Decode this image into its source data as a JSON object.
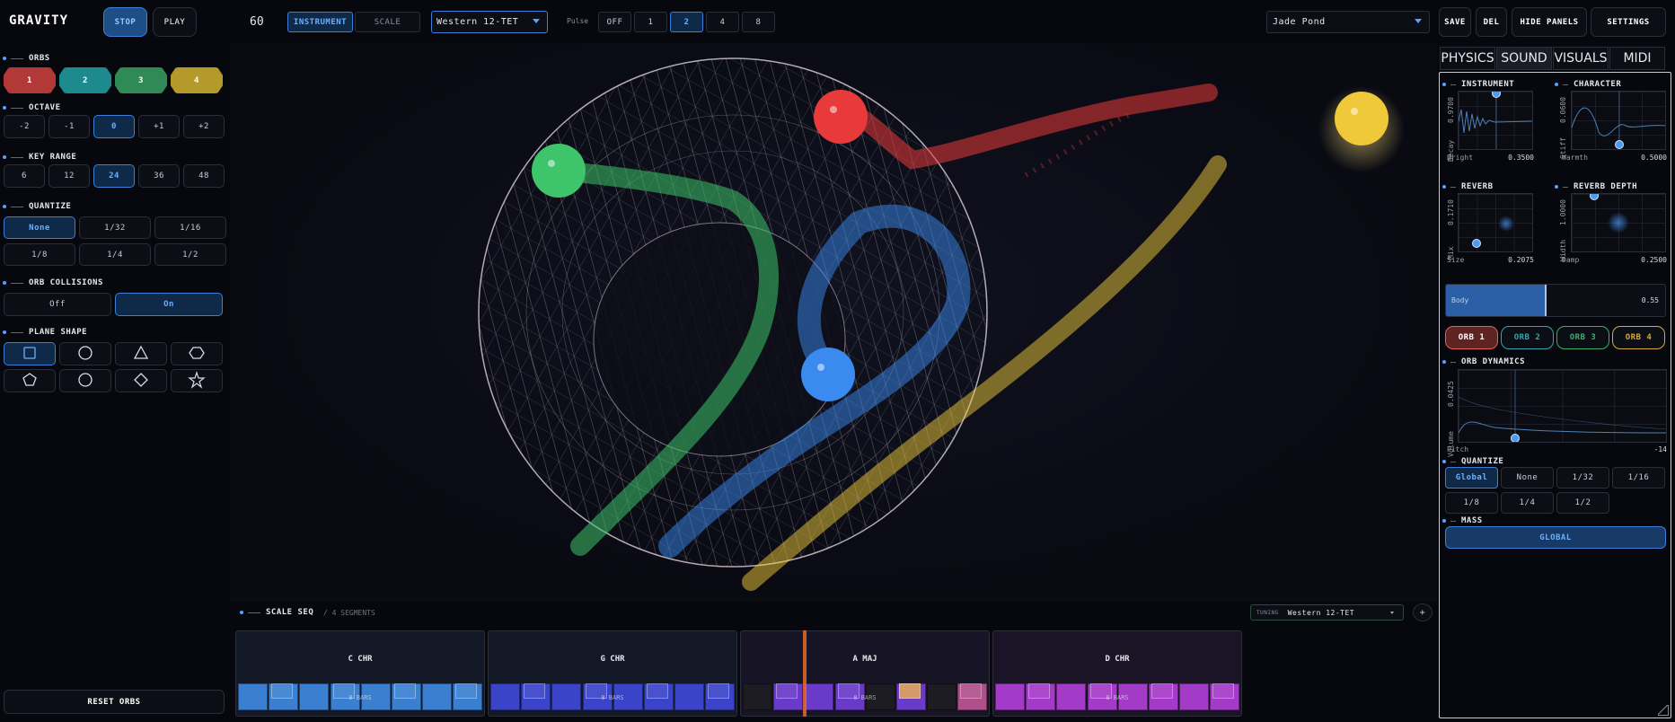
{
  "app": {
    "title": "GRAVITY"
  },
  "transport": {
    "stop_label": "STOP",
    "play_label": "PLAY",
    "bpm": "60"
  },
  "mode": {
    "instrument_label": "INSTRUMENT",
    "scale_label": "SCALE"
  },
  "tuning_select": {
    "value": "Western 12-TET"
  },
  "pulse": {
    "label": "Pulse",
    "options": [
      "OFF",
      "1",
      "2",
      "4",
      "8"
    ],
    "selected": "2"
  },
  "preset": {
    "value": "Jade Pond",
    "save_label": "SAVE",
    "del_label": "DEL",
    "hide_label": "HIDE PANELS",
    "settings_label": "SETTINGS"
  },
  "sidebar": {
    "orbs_label": "ORBS",
    "orbs": [
      {
        "label": "1",
        "color": "#b33838"
      },
      {
        "label": "2",
        "color": "#1d8a8e"
      },
      {
        "label": "3",
        "color": "#2f8a55"
      },
      {
        "label": "4",
        "color": "#b39a2a"
      }
    ],
    "octave_label": "OCTAVE",
    "octave": [
      "-2",
      "-1",
      "0",
      "+1",
      "+2"
    ],
    "octave_selected": "0",
    "keyrange_label": "KEY RANGE",
    "keyrange": [
      "6",
      "12",
      "24",
      "36",
      "48"
    ],
    "keyrange_selected": "24",
    "quantize_label": "QUANTIZE",
    "quantize_row1": [
      "None",
      "1/32",
      "1/16"
    ],
    "quantize_row2": [
      "1/8",
      "1/4",
      "1/2"
    ],
    "quantize_selected": "None",
    "collisions_label": "ORB COLLISIONS",
    "collisions": [
      "Off",
      "On"
    ],
    "collisions_selected": "On",
    "plane_label": "PLANE SHAPE",
    "planes": [
      "square-icon",
      "circle-icon",
      "triangle-icon",
      "hexagon-icon",
      "pentagon-icon",
      "circle-icon",
      "diamond-icon",
      "star-icon"
    ],
    "reset_label": "RESET ORBS"
  },
  "canvas": {
    "orbs": [
      {
        "name": "orb-green",
        "color": "#3ec46a"
      },
      {
        "name": "orb-red",
        "color": "#e83a3a"
      },
      {
        "name": "orb-yellow",
        "color": "#f0c93a"
      },
      {
        "name": "orb-blue",
        "color": "#3a8af0"
      }
    ]
  },
  "right_panel": {
    "tabs": [
      "PHYSICS",
      "SOUND",
      "VISUALS",
      "MIDI"
    ],
    "selected_tab": "SOUND",
    "instrument": {
      "title": "INSTRUMENT",
      "y_label": "Decay",
      "y_value": "0.9700",
      "x_label": "Bright",
      "x_value": "0.3500"
    },
    "character": {
      "title": "CHARACTER",
      "y_label": "Stiff",
      "y_value": "0.0600",
      "x_label": "Warmth",
      "x_value": "0.5000"
    },
    "reverb": {
      "title": "REVERB",
      "y_label": "Mix",
      "y_value": "0.1710",
      "x_label": "Size",
      "x_value": "0.2075"
    },
    "reverb_depth": {
      "title": "REVERB DEPTH",
      "y_label": "Width",
      "y_value": "1.0000",
      "x_label": "Damp",
      "x_value": "0.2500"
    },
    "body": {
      "label": "Body",
      "value": "0.55",
      "fraction": 0.55
    },
    "orb_tabs": [
      {
        "label": "ORB 1",
        "color": "#e0605a"
      },
      {
        "label": "ORB 2",
        "color": "#2fa7ad"
      },
      {
        "label": "ORB 3",
        "color": "#3fae6a"
      },
      {
        "label": "ORB 4",
        "color": "#d9a93a"
      }
    ],
    "dynamics": {
      "title": "ORB DYNAMICS",
      "y_label": "Volume",
      "y_value": "0.0425",
      "x_label": "Pitch",
      "x_value": "-14"
    },
    "quantize": {
      "title": "QUANTIZE",
      "row1": [
        "Global",
        "None",
        "1/32",
        "1/16"
      ],
      "row2": [
        "1/8",
        "1/4",
        "1/2"
      ],
      "selected": "Global"
    },
    "mass": {
      "title": "MASS",
      "value": "GLOBAL"
    }
  },
  "sequencer": {
    "title": "SCALE SEQ",
    "subtitle": "/ 4 SEGMENTS",
    "tuning_label": "TUNING",
    "tuning_value": "Western 12-TET",
    "add_label": "+",
    "segments": [
      {
        "name": "C CHR",
        "bars_label": "8 BARS",
        "color": "#3a7fd0"
      },
      {
        "name": "G CHR",
        "bars_label": "8 BARS",
        "color": "#3a44c8"
      },
      {
        "name": "A MAJ",
        "bars_label": "8 BARS",
        "color": "#6a3ac8"
      },
      {
        "name": "D CHR",
        "bars_label": "8 BARS",
        "color": "#a33ac8"
      }
    ]
  }
}
